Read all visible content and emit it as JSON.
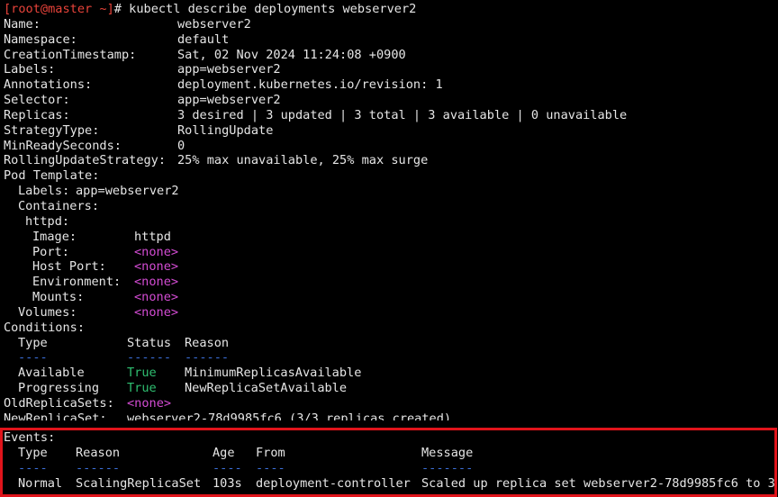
{
  "prompt": {
    "user_host": "[root@master ~]",
    "symbol": "#",
    "command": "kubectl describe deployments webserver2"
  },
  "fields": {
    "name_key": "Name:",
    "name_val": "webserver2",
    "namespace_key": "Namespace:",
    "namespace_val": "default",
    "created_key": "CreationTimestamp:",
    "created_val": "Sat, 02 Nov 2024 11:24:08 +0900",
    "labels_key": "Labels:",
    "labels_val": "app=webserver2",
    "annotations_key": "Annotations:",
    "annotations_val": "deployment.kubernetes.io/revision: 1",
    "selector_key": "Selector:",
    "selector_val": "app=webserver2",
    "replicas_key": "Replicas:",
    "replicas_val": "3 desired | 3 updated | 3 total | 3 available | 0 unavailable",
    "strategy_key": "StrategyType:",
    "strategy_val": "RollingUpdate",
    "minready_key": "MinReadySeconds:",
    "minready_val": "0",
    "rolling_key": "RollingUpdateStrategy:",
    "rolling_val": "25% max unavailable, 25% max surge"
  },
  "pod_template": {
    "header": "Pod Template:",
    "labels_key": "Labels:",
    "labels_val": "app=webserver2",
    "containers_key": "Containers:",
    "container_name": "httpd:",
    "image_key": "Image:",
    "image_val": "httpd",
    "port_key": "Port:",
    "hostport_key": "Host Port:",
    "env_key": "Environment:",
    "mounts_key": "Mounts:",
    "volumes_key": "Volumes:",
    "none": "<none>"
  },
  "conditions": {
    "header": "Conditions:",
    "col_type": "Type",
    "col_status": "Status",
    "col_reason": "Reason",
    "dash_type": "----",
    "dash_status": "------",
    "dash_reason": "------",
    "rows": [
      {
        "type": "Available",
        "status": "True",
        "reason": "MinimumReplicasAvailable"
      },
      {
        "type": "Progressing",
        "status": "True",
        "reason": "NewReplicaSetAvailable"
      }
    ]
  },
  "replica_sets": {
    "old_key": "OldReplicaSets:",
    "old_val": "<none>",
    "new_key": "NewReplicaSet:",
    "new_val": "webserver2-78d9985fc6 (3/3 replicas created)"
  },
  "events": {
    "header": "Events:",
    "col_type": "Type",
    "col_reason": "Reason",
    "col_age": "Age",
    "col_from": "From",
    "col_message": "Message",
    "dash_type": "----",
    "dash_reason": "------",
    "dash_age": "----",
    "dash_from": "----",
    "dash_message": "-------",
    "rows": [
      {
        "type": "Normal",
        "reason": "ScalingReplicaSet",
        "age": "103s",
        "from": "deployment-controller",
        "message": "Scaled up replica set webserver2-78d9985fc6 to 3"
      }
    ]
  },
  "colors": {
    "background": "#000000",
    "text": "#e6e6e6",
    "prompt": "#e8433a",
    "true_status": "#2fbf71",
    "none_value": "#d34cd3",
    "highlight_box": "#e0141b"
  }
}
